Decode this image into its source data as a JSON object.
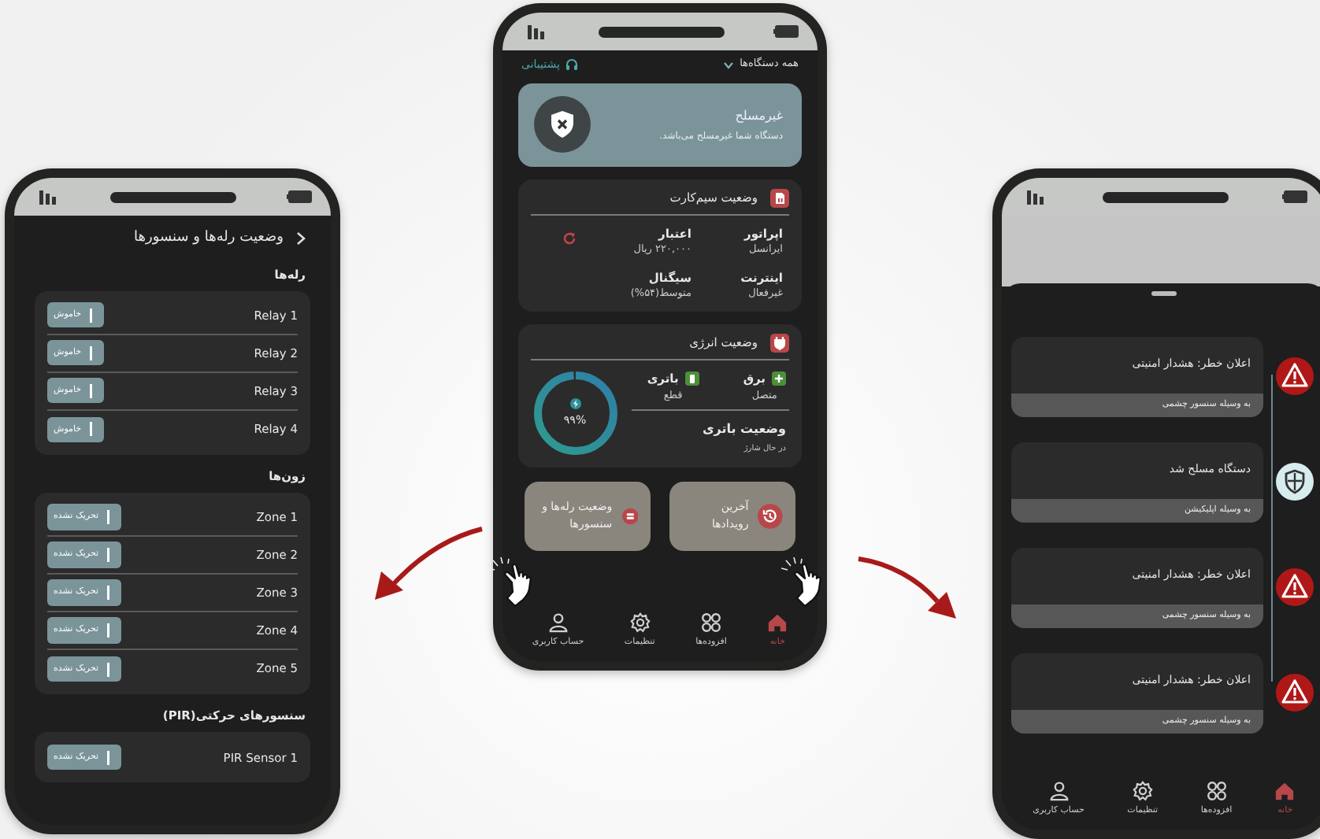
{
  "left_phone": {
    "title": "وضعیت رله‌ها و سنسورها",
    "sections": [
      {
        "heading": "رله‌ها",
        "items": [
          {
            "name": "Relay 1",
            "status": "خاموش"
          },
          {
            "name": "Relay 2",
            "status": "خاموش"
          },
          {
            "name": "Relay 3",
            "status": "خاموش"
          },
          {
            "name": "Relay 4",
            "status": "خاموش"
          }
        ]
      },
      {
        "heading": "زون‌ها",
        "items": [
          {
            "name": "Zone 1",
            "status": "تحریک نشده"
          },
          {
            "name": "Zone 2",
            "status": "تحریک نشده"
          },
          {
            "name": "Zone 3",
            "status": "تحریک نشده"
          },
          {
            "name": "Zone 4",
            "status": "تحریک نشده"
          },
          {
            "name": "Zone 5",
            "status": "تحریک نشده"
          }
        ]
      },
      {
        "heading": "سنسورهای حرکتی(PIR)",
        "items": [
          {
            "name": "PIR Sensor 1",
            "status": "تحریک نشده"
          }
        ]
      }
    ]
  },
  "center_phone": {
    "device_selector": "همه دستگاه‌ها",
    "support": "پشتیبانی",
    "arm_status": {
      "title": "غیرمسلح",
      "subtitle": "دستگاه شما غیرمسلح می‌باشد."
    },
    "sim_card": {
      "title": "وضعیت سیم‌کارت",
      "fields": [
        {
          "label": "اپراتور",
          "value": "ایرانسل"
        },
        {
          "label": "اعتبار",
          "value": "۲۲۰,۰۰۰ ریال"
        },
        {
          "label": "اینترنت",
          "value": "غیرفعال"
        },
        {
          "label": "سیگنال",
          "value": "متوسط(۵۴%)"
        }
      ]
    },
    "energy": {
      "title": "وضعیت انرژی",
      "sources": [
        {
          "kind": "mains",
          "label": "برق",
          "value": "متصل"
        },
        {
          "kind": "battery",
          "label": "باتری",
          "value": "قطع"
        }
      ],
      "battery_status": {
        "label": "وضعیت باتری",
        "value": "در حال شارژ"
      },
      "battery_percent": "۹۹%",
      "level": 0.99
    },
    "shortcuts": [
      {
        "kind": "events",
        "label": "آخرین رویدادها"
      },
      {
        "kind": "relays",
        "label": "وضعیت رله‌ها و سنسورها"
      }
    ],
    "nav": [
      {
        "kind": "home",
        "label": "خانه",
        "selected": true
      },
      {
        "kind": "addons",
        "label": "افزوده‌ها",
        "selected": false
      },
      {
        "kind": "settings",
        "label": "تنظیمات",
        "selected": false
      },
      {
        "kind": "account",
        "label": "حساب کاربری",
        "selected": false
      }
    ]
  },
  "right_phone": {
    "events": [
      {
        "kind": "alarm",
        "title": "اعلان خطر: هشدار امنیتی",
        "source": "به وسیله سنسور چشمی"
      },
      {
        "kind": "armed",
        "title": "دستگاه مسلح شد",
        "source": "به وسیله اپلیکیشن"
      },
      {
        "kind": "alarm",
        "title": "اعلان خطر: هشدار امنیتی",
        "source": "به وسیله سنسور چشمی"
      },
      {
        "kind": "alarm",
        "title": "اعلان خطر: هشدار امنیتی",
        "source": "به وسیله سنسور چشمی"
      }
    ],
    "nav": [
      {
        "kind": "home",
        "label": "خانه",
        "selected": true
      },
      {
        "kind": "addons",
        "label": "افزوده‌ها",
        "selected": false
      },
      {
        "kind": "settings",
        "label": "تنظیمات",
        "selected": false
      },
      {
        "kind": "account",
        "label": "حساب کاربری",
        "selected": false
      }
    ]
  }
}
